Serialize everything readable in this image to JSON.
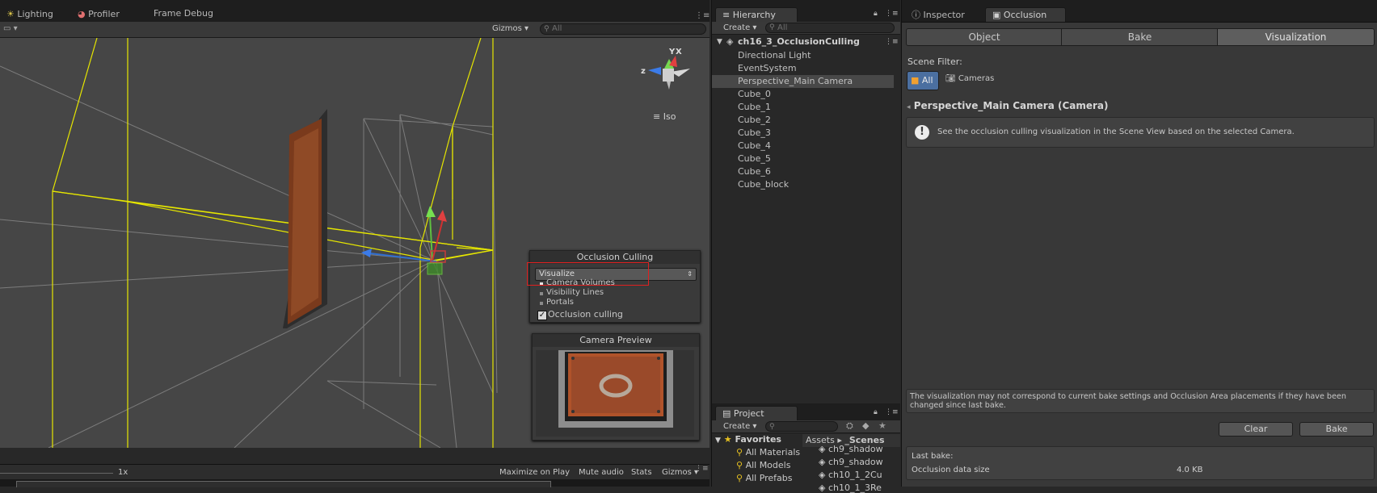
{
  "scene_tabs": {
    "lighting": "Lighting",
    "profiler": "Profiler",
    "frame_debug": "Frame Debug"
  },
  "scene_toolbar": {
    "gizmos": "Gizmos",
    "search_placeholder": "All"
  },
  "gizmo": {
    "x_label": "X",
    "y_label": "Y",
    "z_label": "z",
    "projection": "Iso"
  },
  "occlusion_overlay": {
    "title": "Occlusion Culling",
    "mode_selected": "Visualize",
    "options": [
      "Camera Volumes",
      "Visibility Lines",
      "Portals"
    ],
    "occlusion_checkbox_label": "Occlusion culling",
    "occlusion_checked": true
  },
  "camera_preview": {
    "title": "Camera Preview"
  },
  "game_bar": {
    "scale": "1x",
    "maximize_on_play": "Maximize on Play",
    "mute_audio": "Mute audio",
    "stats": "Stats",
    "gizmos": "Gizmos"
  },
  "hierarchy": {
    "tab": "Hierarchy",
    "create": "Create",
    "search_placeholder": "All",
    "scene_name": "ch16_3_OcclusionCulling",
    "items": [
      "Directional Light",
      "EventSystem",
      "Perspective_Main Camera",
      "Cube_0",
      "Cube_1",
      "Cube_2",
      "Cube_3",
      "Cube_4",
      "Cube_5",
      "Cube_6",
      "Cube_block"
    ],
    "selected_index": 2
  },
  "project": {
    "tab": "Project",
    "create": "Create",
    "favorites_label": "Favorites",
    "favorites": [
      "All Materials",
      "All Models",
      "All Prefabs"
    ],
    "breadcrumb_root": "Assets",
    "breadcrumb_sep": "▸",
    "breadcrumb_current": "_Scenes",
    "files": [
      "ch9_shadow",
      "ch9_shadow",
      "ch10_1_2Cu",
      "ch10_1_3Re"
    ]
  },
  "inspector_tabs": {
    "inspector": "Inspector",
    "occlusion": "Occlusion"
  },
  "occlusion_window": {
    "modes": [
      "Object",
      "Bake",
      "Visualization"
    ],
    "selected_mode": 2,
    "scene_filter_label": "Scene Filter:",
    "filter_all": "All",
    "filter_cameras": "Cameras",
    "camera_name": "Perspective_Main Camera (Camera)",
    "info_message": "See the occlusion culling visualization in the Scene View based on the selected Camera.",
    "warning_line1": "The visualization may not correspond to current bake settings and Occlusion Area placements if they have been",
    "warning_line2": "changed since last bake.",
    "clear_button": "Clear",
    "bake_button": "Bake",
    "last_bake_label": "Last bake:",
    "occlusion_data_size_label": "Occlusion data size",
    "occlusion_data_size_value": "4.0 KB"
  },
  "colors": {
    "highlight_box": "#e02020",
    "frustum": "#e6e600",
    "selection": "#4b6fa0"
  }
}
